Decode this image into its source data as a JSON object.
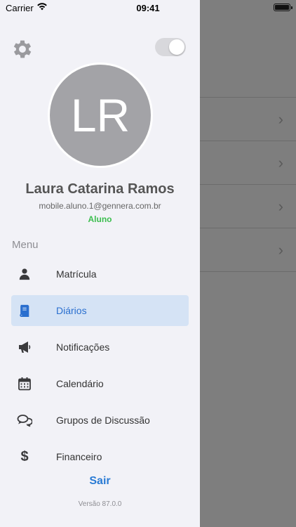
{
  "status_bar": {
    "carrier": "Carrier",
    "time": "09:41"
  },
  "profile": {
    "initials": "LR",
    "name": "Laura Catarina Ramos",
    "email": "mobile.aluno.1@gennera.com.br",
    "role": "Aluno",
    "role_color": "#3cbe4f"
  },
  "menu": {
    "section_label": "Menu",
    "items": [
      {
        "label": "Matrícula",
        "icon": "person-icon"
      },
      {
        "label": "Diários",
        "icon": "book-icon",
        "active": true
      },
      {
        "label": "Notificações",
        "icon": "megaphone-icon"
      },
      {
        "label": "Calendário",
        "icon": "calendar-icon"
      },
      {
        "label": "Grupos de Discussão",
        "icon": "chat-bubbles-icon"
      },
      {
        "label": "Financeiro",
        "icon": "dollar-icon"
      }
    ]
  },
  "footer": {
    "logout_label": "Sair",
    "version": "Versão 87.0.0"
  },
  "colors": {
    "accent": "#2a7bd4",
    "active_bg": "#d5e3f5",
    "overlay": "#7e7e7e"
  }
}
